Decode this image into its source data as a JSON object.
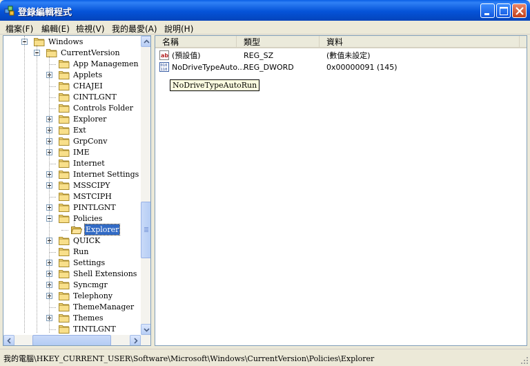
{
  "window": {
    "title": "登錄編輯程式",
    "icon": "regedit-icon"
  },
  "menu": [
    {
      "label": "檔案(F)"
    },
    {
      "label": "編輯(E)"
    },
    {
      "label": "檢視(V)"
    },
    {
      "label": "我的最愛(A)"
    },
    {
      "label": "說明(H)"
    }
  ],
  "tree": {
    "items": [
      {
        "label": "Windows",
        "expander": "minus"
      },
      {
        "label": "CurrentVersion",
        "expander": "minus"
      },
      {
        "label": "App Managemen",
        "expander": "none"
      },
      {
        "label": "Applets",
        "expander": "plus"
      },
      {
        "label": "CHAJEI",
        "expander": "none"
      },
      {
        "label": "CINTLGNT",
        "expander": "none"
      },
      {
        "label": "Controls Folder",
        "expander": "none"
      },
      {
        "label": "Explorer",
        "expander": "plus"
      },
      {
        "label": "Ext",
        "expander": "plus"
      },
      {
        "label": "GrpConv",
        "expander": "plus"
      },
      {
        "label": "IME",
        "expander": "plus"
      },
      {
        "label": "Internet",
        "expander": "none"
      },
      {
        "label": "Internet Settings",
        "expander": "plus"
      },
      {
        "label": "MSSCIPY",
        "expander": "plus"
      },
      {
        "label": "MSTCIPH",
        "expander": "none"
      },
      {
        "label": "PINTLGNT",
        "expander": "plus"
      },
      {
        "label": "Policies",
        "expander": "minus"
      },
      {
        "label": "Explorer",
        "expander": "none",
        "selected": true
      },
      {
        "label": "QUICK",
        "expander": "plus"
      },
      {
        "label": "Run",
        "expander": "none"
      },
      {
        "label": "Settings",
        "expander": "plus"
      },
      {
        "label": "Shell Extensions",
        "expander": "plus"
      },
      {
        "label": "Syncmgr",
        "expander": "plus"
      },
      {
        "label": "Telephony",
        "expander": "plus"
      },
      {
        "label": "ThemeManager",
        "expander": "none"
      },
      {
        "label": "Themes",
        "expander": "plus"
      },
      {
        "label": "TINTLGNT",
        "expander": "none"
      }
    ]
  },
  "list": {
    "columns": [
      "名稱",
      "類型",
      "資料"
    ],
    "rows": [
      {
        "icon": "string-value-icon",
        "name": "(預設值)",
        "type": "REG_SZ",
        "data": "(數值未設定)"
      },
      {
        "icon": "binary-value-icon",
        "name": "NoDriveTypeAuto...",
        "type": "REG_DWORD",
        "data": "0x00000091 (145)"
      }
    ],
    "tooltip": "NoDriveTypeAutoRun"
  },
  "status": {
    "path": "我的電腦\\HKEY_CURRENT_USER\\Software\\Microsoft\\Windows\\CurrentVersion\\Policies\\Explorer"
  },
  "colors": {
    "titlebar": "#0553d8",
    "selection": "#316ac5",
    "tooltip_bg": "#ffffe1",
    "folder": "#f5d77a"
  }
}
